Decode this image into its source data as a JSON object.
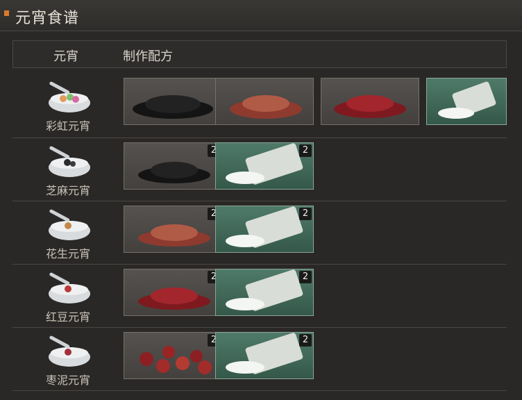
{
  "header": {
    "title": "元宵食谱"
  },
  "table": {
    "col_dish": "元宵",
    "col_recipe": "制作配方",
    "rows": [
      {
        "name": "彩虹元宵",
        "ingredients": [
          {
            "item": "black-sesame-icon",
            "count": ""
          },
          {
            "item": "peanut-icon",
            "count": ""
          },
          {
            "item": "red-bean-icon",
            "count": ""
          },
          {
            "item": "rice-flour-bag-icon",
            "count": ""
          }
        ]
      },
      {
        "name": "芝麻元宵",
        "ingredients": [
          {
            "item": "black-sesame-icon",
            "count": "2"
          },
          {
            "item": "rice-flour-bag-icon",
            "count": "2"
          }
        ]
      },
      {
        "name": "花生元宵",
        "ingredients": [
          {
            "item": "peanut-icon",
            "count": "2"
          },
          {
            "item": "rice-flour-bag-icon",
            "count": "2"
          }
        ]
      },
      {
        "name": "红豆元宵",
        "ingredients": [
          {
            "item": "red-bean-icon",
            "count": "2"
          },
          {
            "item": "rice-flour-bag-icon",
            "count": "2"
          }
        ]
      },
      {
        "name": "枣泥元宵",
        "ingredients": [
          {
            "item": "red-date-icon",
            "count": "2"
          },
          {
            "item": "rice-flour-bag-icon",
            "count": "2"
          }
        ]
      }
    ]
  },
  "colors": {
    "accent": "#d77b2b",
    "background": "#2a2826",
    "rice_tile": "#4f7a6a"
  }
}
